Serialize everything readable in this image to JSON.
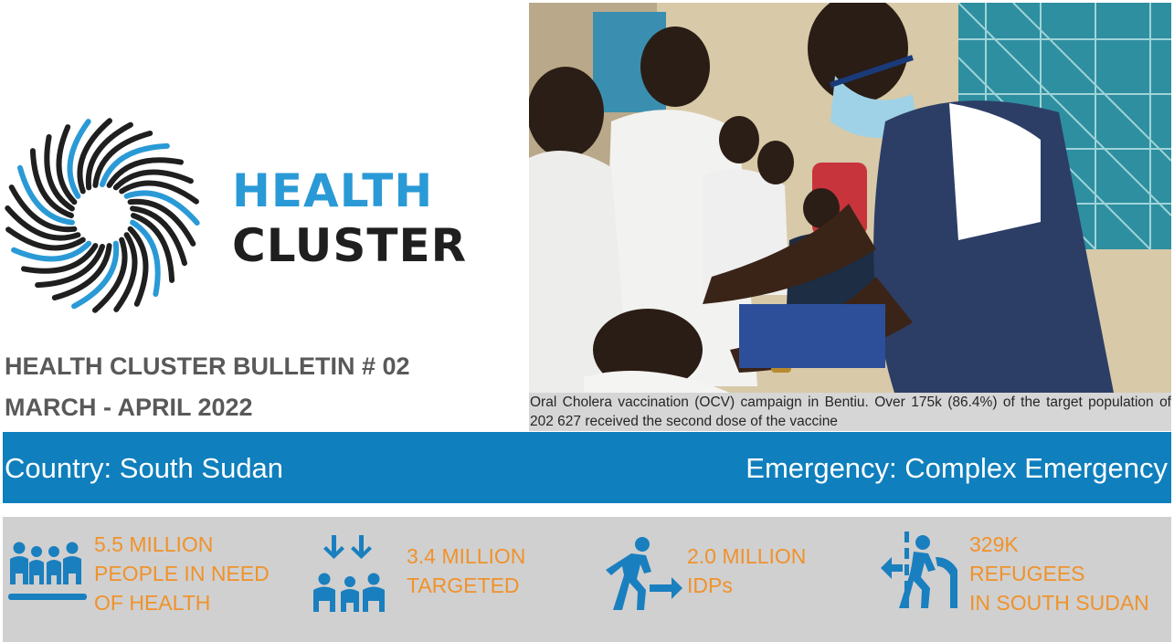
{
  "logo": {
    "line1": "HEALTH",
    "line2": "CLUSTER",
    "colors": {
      "blue": "#2a9ad6",
      "dark": "#1f1f1f"
    },
    "icon": "spiral-burst-logo-icon"
  },
  "bulletin": {
    "title": "HEALTH CLUSTER BULLETIN # 02",
    "period": "MARCH - APRIL 2022"
  },
  "photo": {
    "caption": "Oral Cholera vaccination (OCV) campaign in Bentiu. Over 175k (86.4%) of the target population of 202 627 received the second dose of the vaccine"
  },
  "country_bar": {
    "country": "Country: South Sudan",
    "emergency": "Emergency: Complex Emergency",
    "color": "#0f7fbd"
  },
  "stats": [
    {
      "icon": "people-in-need-icon",
      "lines": [
        "5.5 MILLION",
        "PEOPLE IN NEED",
        "OF HEALTH"
      ]
    },
    {
      "icon": "targeted-people-icon",
      "lines": [
        "3.4 MILLION",
        "TARGETED"
      ]
    },
    {
      "icon": "idp-person-walking-icon",
      "lines": [
        "2.0 MILLION",
        "IDPs"
      ]
    },
    {
      "icon": "refugee-crossing-border-icon",
      "lines": [
        "329K",
        "REFUGEES",
        "IN SOUTH SUDAN"
      ]
    }
  ],
  "colors": {
    "stat_text": "#f0922b",
    "stat_icon": "#1a7fbf",
    "stats_background": "#d0d0d0"
  }
}
